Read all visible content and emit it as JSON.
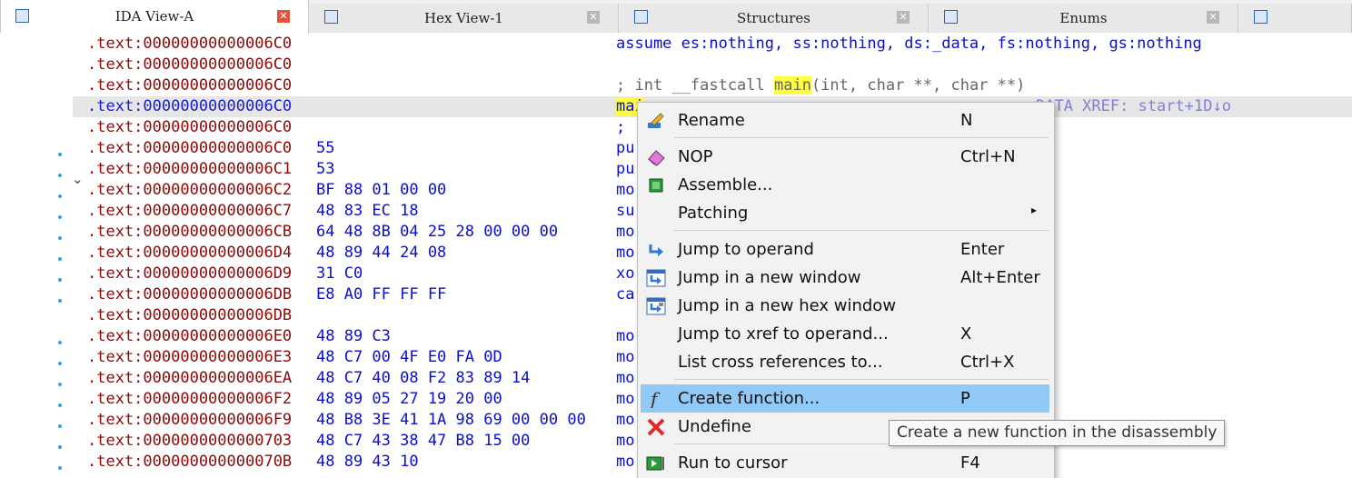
{
  "tabs": [
    {
      "label": "IDA View-A",
      "icon": "ida-view-icon",
      "active": true
    },
    {
      "label": "Hex View-1",
      "icon": "hex-view-icon",
      "active": false
    },
    {
      "label": "Structures",
      "icon": "structures-icon",
      "active": false
    },
    {
      "label": "Enums",
      "icon": "enums-icon",
      "active": false
    }
  ],
  "tab_close_glyph": "✕",
  "listing": {
    "rows": [
      {
        "addr": ".text:00000000000006C0",
        "bytes": "",
        "instr": "assume es:nothing, ss:nothing, ds:_data, fs:nothing, gs:nothing"
      },
      {
        "addr": ".text:00000000000006C0",
        "bytes": "",
        "instr": ""
      },
      {
        "addr": ".text:00000000000006C0",
        "bytes": "",
        "instr_prefix": "; int __fastcall ",
        "instr_hl": "main",
        "instr_suffix": "(int, char **, char **)"
      },
      {
        "addr": ".text:00000000000006C0",
        "bytes": "",
        "instr_hl": "mai",
        "xref": "DATA XREF: start+1D↓o",
        "selected": true
      },
      {
        "addr": ".text:00000000000006C0",
        "bytes": "",
        "instr": ";"
      },
      {
        "addr": ".text:00000000000006C0",
        "bytes": "55",
        "instr": "pu"
      },
      {
        "addr": ".text:00000000000006C1",
        "bytes": "53",
        "instr": "pu"
      },
      {
        "addr": ".text:00000000000006C2",
        "bytes": "BF 88 01 00 00",
        "instr": "mo"
      },
      {
        "addr": ".text:00000000000006C7",
        "bytes": "48 83 EC 18",
        "instr": "su"
      },
      {
        "addr": ".text:00000000000006CB",
        "bytes": "64 48 8B 04 25 28 00 00 00",
        "instr": "mo"
      },
      {
        "addr": ".text:00000000000006D4",
        "bytes": "48 89 44 24 08",
        "instr": "mo"
      },
      {
        "addr": ".text:00000000000006D9",
        "bytes": "31 C0",
        "instr": "xo"
      },
      {
        "addr": ".text:00000000000006DB",
        "bytes": "E8 A0 FF FF FF",
        "instr": "ca"
      },
      {
        "addr": ".text:00000000000006DB",
        "bytes": "",
        "instr": ""
      },
      {
        "addr": ".text:00000000000006E0",
        "bytes": "48 89 C3",
        "instr": "mo"
      },
      {
        "addr": ".text:00000000000006E3",
        "bytes": "48 C7 00 4F E0 FA 0D",
        "instr": "mo"
      },
      {
        "addr": ".text:00000000000006EA",
        "bytes": "48 C7 40 08 F2 83 89 14",
        "instr": "mo"
      },
      {
        "addr": ".text:00000000000006F2",
        "bytes": "48 89 05 27 19 20 00",
        "instr": "mo"
      },
      {
        "addr": ".text:00000000000006F9",
        "bytes": "48 B8 3E 41 1A 98 69 00 00 00",
        "instr": "mo"
      },
      {
        "addr": ".text:0000000000000703",
        "bytes": "48 C7 43 38 47 B8 15 00",
        "instr": "mo"
      },
      {
        "addr": ".text:000000000000070B",
        "bytes": "48 89 43 10",
        "instr": "mo"
      }
    ]
  },
  "context_menu": {
    "items": [
      {
        "label": "Rename",
        "shortcut": "N",
        "icon": "rename-icon"
      },
      {
        "label": "NOP",
        "shortcut": "Ctrl+N",
        "icon": "eraser-icon"
      },
      {
        "label": "Assemble...",
        "shortcut": "",
        "icon": "chip-icon"
      },
      {
        "label": "Patching",
        "shortcut": "",
        "icon": "",
        "submenu_arrow": "▸"
      },
      {
        "label": "Jump to operand",
        "shortcut": "Enter",
        "icon": "jump-arrow-icon"
      },
      {
        "label": "Jump in a new window",
        "shortcut": "Alt+Enter",
        "icon": "jump-new-window-icon"
      },
      {
        "label": "Jump in a new hex window",
        "shortcut": "",
        "icon": "jump-hex-window-icon"
      },
      {
        "label": "Jump to xref to operand...",
        "shortcut": "X",
        "icon": ""
      },
      {
        "label": "List cross references to...",
        "shortcut": "Ctrl+X",
        "icon": ""
      },
      {
        "label": "Create function...",
        "shortcut": "P",
        "icon": "function-icon",
        "highlighted": true
      },
      {
        "label": "Undefine",
        "shortcut": "",
        "icon": "undefine-x-icon"
      },
      {
        "label": "Run to cursor",
        "shortcut": "F4",
        "icon": "run-to-cursor-icon"
      }
    ]
  },
  "tooltip": "Create a new function in the disassembly",
  "colors": {
    "address": "#8b0a0a",
    "selected_address": "#1a1ad0",
    "bytes": "#0b10c8",
    "highlight": "#ffff40",
    "menu_hot": "#91c9f7",
    "active_close": "#e0533f"
  }
}
